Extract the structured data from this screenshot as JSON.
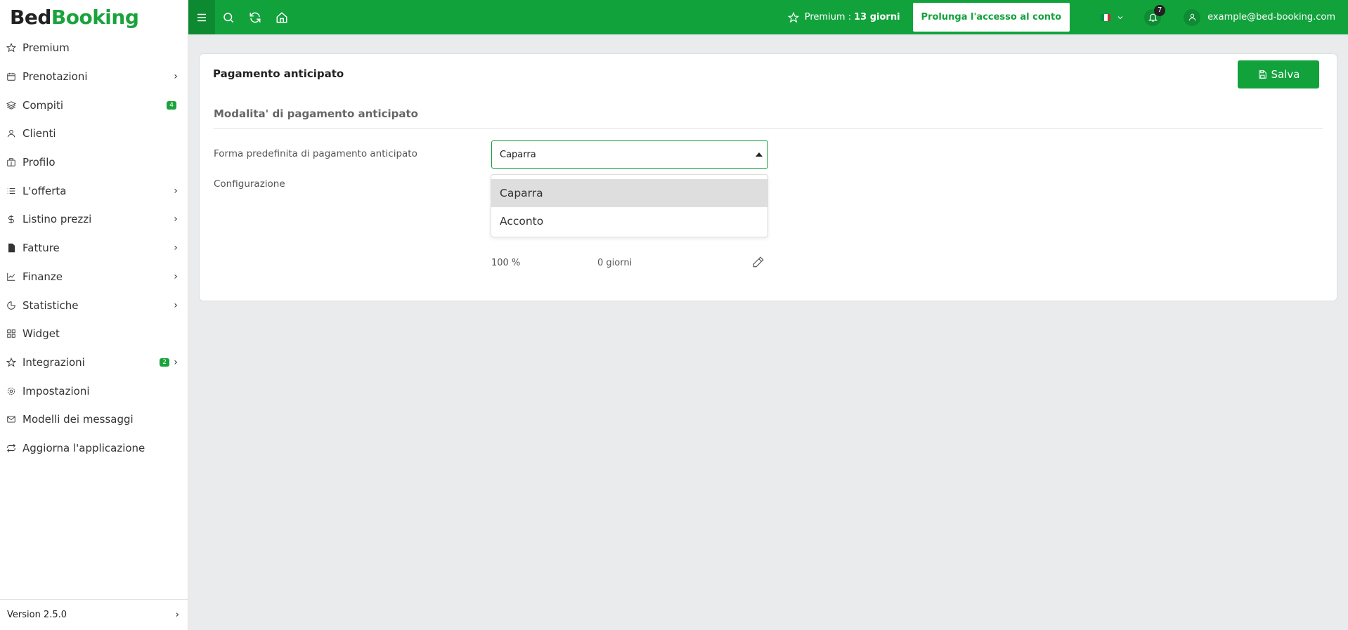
{
  "logo": {
    "part1": "Bed",
    "part2": "Booking"
  },
  "sidebar": {
    "items": [
      {
        "label": "Premium",
        "icon": "star-icon"
      },
      {
        "label": "Prenotazioni",
        "icon": "calendar-icon",
        "chevron": true
      },
      {
        "label": "Compiti",
        "icon": "layers-icon",
        "badge": "4"
      },
      {
        "label": "Clienti",
        "icon": "user-icon"
      },
      {
        "label": "Profilo",
        "icon": "building-icon"
      },
      {
        "label": "L'offerta",
        "icon": "list-icon",
        "chevron": true
      },
      {
        "label": "Listino prezzi",
        "icon": "dollar-icon",
        "chevron": true
      },
      {
        "label": "Fatture",
        "icon": "invoice-icon",
        "chevron": true
      },
      {
        "label": "Finanze",
        "icon": "chart-icon",
        "chevron": true
      },
      {
        "label": "Statistiche",
        "icon": "pie-icon",
        "chevron": true
      },
      {
        "label": "Widget",
        "icon": "grid-icon"
      },
      {
        "label": "Integrazioni",
        "icon": "star-icon",
        "badge": "2",
        "chevron": true
      },
      {
        "label": "Impostazioni",
        "icon": "gear-icon"
      },
      {
        "label": "Modelli dei messaggi",
        "icon": "mail-icon"
      },
      {
        "label": "Aggiorna l'applicazione",
        "icon": "refresh-icon"
      }
    ],
    "version": "Version 2.5.0"
  },
  "topbar": {
    "premium_label": "Premium :",
    "premium_days": "13 giorni",
    "extend_button": "Prolunga l'accesso al conto",
    "notifications_count": "7",
    "user_email": "example@bed-booking.com",
    "colors": {
      "bar": "#12a23c",
      "menu_bg": "#0d8a31"
    }
  },
  "card": {
    "title": "Pagamento anticipato",
    "save_label": "Salva",
    "section_title": "Modalita' di pagamento anticipato",
    "default_label": "Forma predefinita di pagamento anticipato",
    "select_value": "Caparra",
    "config_label": "Configurazione",
    "config_percent": "100 %",
    "config_days": "0 giorni",
    "dropdown_options": [
      "Caparra",
      "Acconto"
    ]
  }
}
